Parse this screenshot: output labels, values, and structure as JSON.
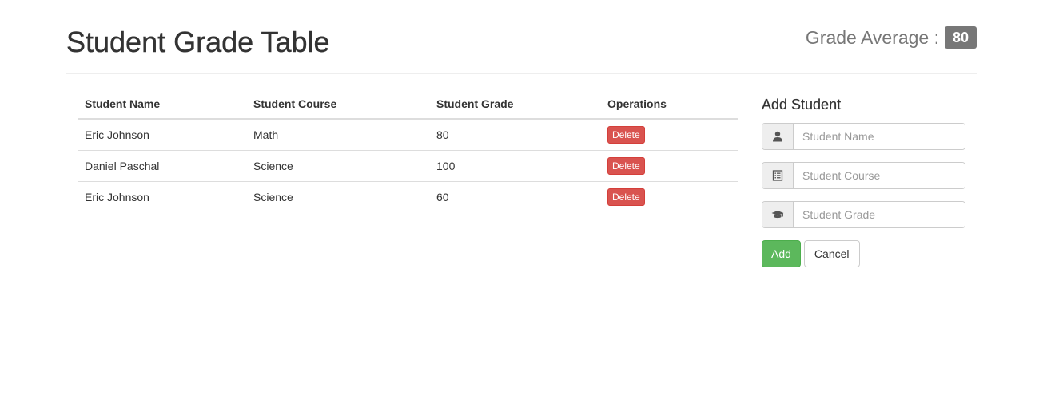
{
  "header": {
    "title": "Student Grade Table",
    "average_label": "Grade Average :",
    "average_value": "80"
  },
  "table": {
    "columns": [
      "Student Name",
      "Student Course",
      "Student Grade",
      "Operations"
    ],
    "rows": [
      {
        "name": "Eric Johnson",
        "course": "Math",
        "grade": "80",
        "action": "Delete"
      },
      {
        "name": "Daniel Paschal",
        "course": "Science",
        "grade": "100",
        "action": "Delete"
      },
      {
        "name": "Eric Johnson",
        "course": "Science",
        "grade": "60",
        "action": "Delete"
      }
    ]
  },
  "form": {
    "title": "Add Student",
    "name_placeholder": "Student Name",
    "course_placeholder": "Student Course",
    "grade_placeholder": "Student Grade",
    "name_icon": "user-icon",
    "course_icon": "list-icon",
    "grade_icon": "graduation-cap-icon",
    "add_label": "Add",
    "cancel_label": "Cancel"
  },
  "colors": {
    "danger": "#d9534f",
    "success": "#5cb85c",
    "badge": "#777777"
  }
}
